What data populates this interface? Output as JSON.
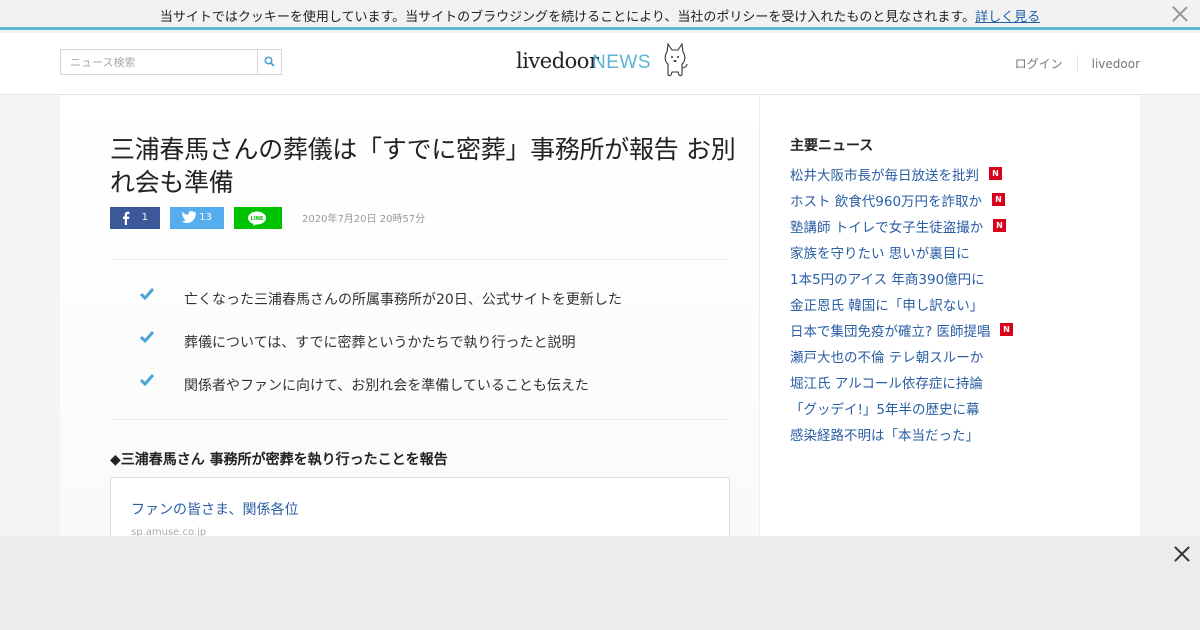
{
  "cookie_bar": {
    "text": "当サイトではクッキーを使用しています。当サイトのブラウジングを続けることにより、当社のポリシーを受け入れたものと見なされます。",
    "link": "詳しく見る",
    "close_icon": "close-icon"
  },
  "header": {
    "search": {
      "placeholder": "ニュース検索",
      "icon": "search-icon"
    },
    "logo": {
      "live": "livedoor",
      "news": "NEWS"
    },
    "links": {
      "login": "ログイン",
      "livedoor": "livedoor"
    }
  },
  "article": {
    "title": "三浦春馬さんの葬儀は「すでに密葬」事務所が報告 お別れ会も準備",
    "share": {
      "facebook_count": "1",
      "twitter_count": "13",
      "line_label": "LINE"
    },
    "date": "2020年7月20日 20時57分",
    "summary": [
      "亡くなった三浦春馬さんの所属事務所が20日、公式サイトを更新した",
      "葬儀については、すでに密葬というかたちで執り行ったと説明",
      "関係者やファンに向けて、お別れ会を準備していることも伝えた"
    ],
    "section_heading": "◆三浦春馬さん 事務所が密葬を執り行ったことを報告",
    "embed": {
      "title": "ファンの皆さま、関係各位",
      "domain": "sp.amuse.co.jp"
    }
  },
  "sidebar": {
    "title": "主要ニュース",
    "new_badge": "N",
    "items": [
      {
        "text": "松井大阪市長が毎日放送を批判",
        "new": true
      },
      {
        "text": "ホスト 飲食代960万円を詐取か",
        "new": true
      },
      {
        "text": "塾講師 トイレで女子生徒盗撮か",
        "new": true
      },
      {
        "text": "家族を守りたい 思いが裏目に",
        "new": false
      },
      {
        "text": "1本5円のアイス 年商390億円に",
        "new": false
      },
      {
        "text": "金正恩氏 韓国に「申し訳ない」",
        "new": false
      },
      {
        "text": "日本で集団免疫が確立? 医師提唱",
        "new": true
      },
      {
        "text": "瀬戸大也の不倫 テレ朝スルーか",
        "new": false
      },
      {
        "text": "堀江氏 アルコール依存症に持論",
        "new": false
      },
      {
        "text": "「グッデイ!」5年半の歴史に幕",
        "new": false
      },
      {
        "text": "感染経路不明は「本当だった」",
        "new": false
      }
    ]
  },
  "colors": {
    "accent": "#5bbcd0",
    "link": "#2a5ea4",
    "facebook": "#3b5998",
    "twitter": "#55acee",
    "line": "#00c300",
    "new_badge": "#d9001b",
    "check": "#4aa3d6"
  }
}
